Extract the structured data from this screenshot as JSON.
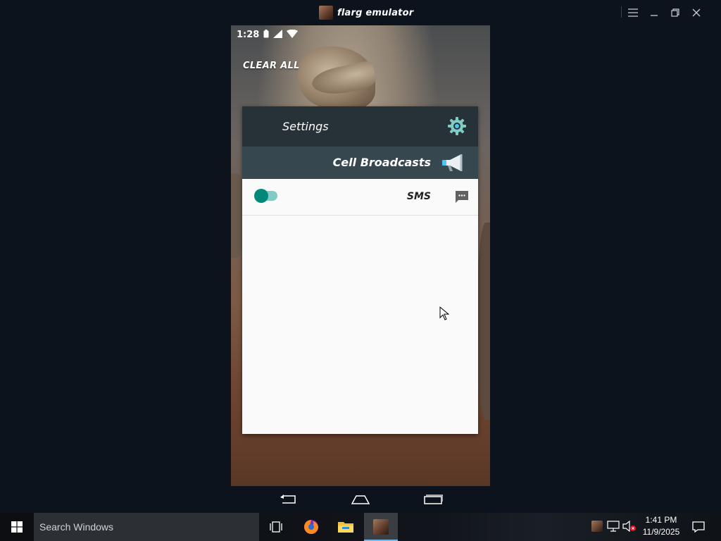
{
  "window": {
    "title": "flarg emulator",
    "controls": [
      "menu-icon",
      "minimize-icon",
      "restore-icon",
      "close-icon"
    ]
  },
  "phone": {
    "status_time": "1:28",
    "status_icons": [
      "battery-icon",
      "signal-icon",
      "wifi-icon"
    ],
    "clear_all": "CLEAR ALL",
    "card": {
      "header": "Settings",
      "subheader": "Cell Broadcasts",
      "row_label": "SMS",
      "toggle_on": true
    },
    "nav": [
      "back-icon",
      "home-icon",
      "recents-icon"
    ]
  },
  "taskbar": {
    "search_placeholder": "Search Windows",
    "pinned": [
      "task-view-icon",
      "firefox-icon",
      "file-explorer-icon",
      "flarg-emulator-icon"
    ],
    "clock_time": "1:41 PM",
    "clock_date": "11/9/2025"
  },
  "colors": {
    "card_header": "#263238",
    "card_subheader": "#37474f",
    "toggle_accent": "#00897b",
    "taskbar_active": "#78b6e6"
  }
}
